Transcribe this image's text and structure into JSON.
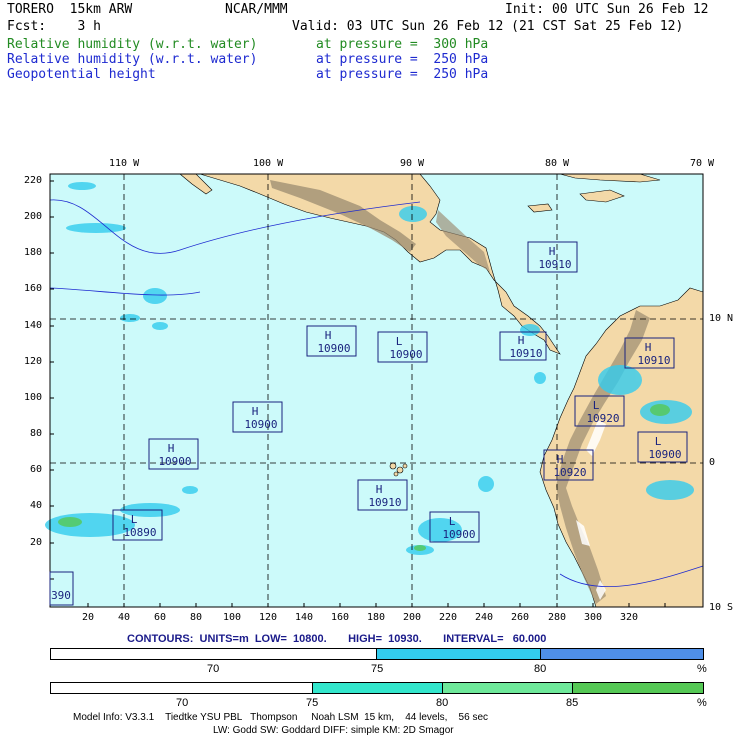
{
  "header": {
    "model": "TORERO  15km ARW",
    "fcst_line": "Fcst:    3 h",
    "center": "NCAR/MMM",
    "init": "Init: 00 UTC Sun 26 Feb 12",
    "valid": "Valid: 03 UTC Sun 26 Feb 12 (21 CST Sat 25 Feb 12)",
    "fields": [
      {
        "name": "Relative humidity (w.r.t. water)",
        "level": "at pressure =  300 hPa",
        "color": "#228b22"
      },
      {
        "name": "Relative humidity (w.r.t. water)",
        "level": "at pressure =  250 hPa",
        "color": "#1e2ad0"
      },
      {
        "name": "Geopotential height",
        "level": "at pressure =  250 hPa",
        "color": "#1e2ad0"
      }
    ]
  },
  "map": {
    "colors": {
      "ocean": "#ccfafa",
      "land": "#f3d9a8",
      "highland": "#9b8b70",
      "box": "#1a237e",
      "grid": "#000000"
    },
    "top_lon_labels": [
      "110 W",
      "100 W",
      "90 W",
      "80 W",
      "70 W"
    ],
    "right_lat_labels": [
      "10 N",
      "0",
      "10 S"
    ],
    "x_ticks": [
      "20",
      "40",
      "60",
      "80",
      "100",
      "120",
      "140",
      "160",
      "180",
      "200",
      "220",
      "240",
      "260",
      "280",
      "300",
      "320"
    ],
    "y_ticks": [
      "220",
      "200",
      "180",
      "160",
      "140",
      "120",
      "100",
      "80",
      "60",
      "40",
      "20"
    ],
    "centers": [
      {
        "type": "H",
        "value": "10910"
      },
      {
        "type": "H",
        "value": "10900"
      },
      {
        "type": "L",
        "value": "10900"
      },
      {
        "type": "H",
        "value": "10910"
      },
      {
        "type": "H",
        "value": "10910"
      },
      {
        "type": "H",
        "value": "10900"
      },
      {
        "type": "L",
        "value": "10920"
      },
      {
        "type": "H",
        "value": "10900"
      },
      {
        "type": "L",
        "value": "10900"
      },
      {
        "type": "H",
        "value": "10920"
      },
      {
        "type": "H",
        "value": "10910"
      },
      {
        "type": "L",
        "value": "10890"
      },
      {
        "type": "L",
        "value": "10900"
      },
      {
        "type": "",
        "value": "390"
      }
    ]
  },
  "contours": {
    "line": "CONTOURS:  UNITS=m  LOW=  10800.       HIGH=  10930.       INTERVAL=   60.000"
  },
  "colorbar1": {
    "segments": [
      "#ffffff",
      "#33ccee",
      "#4f8fe8"
    ],
    "labels": [
      "70",
      "75",
      "80",
      "%"
    ]
  },
  "colorbar2": {
    "segments": [
      "#ffffff",
      "#33e6cc",
      "#6ee89a",
      "#55c855"
    ],
    "labels": [
      "70",
      "75",
      "80",
      "85",
      "%"
    ]
  },
  "footer": {
    "line1": "Model Info: V3.3.1    Tiedtke YSU PBL   Thompson     Noah LSM  15 km,    44 levels,    56 sec",
    "line2": "LW: Godd SW: Goddard DIFF: simple KM: 2D Smagor"
  }
}
